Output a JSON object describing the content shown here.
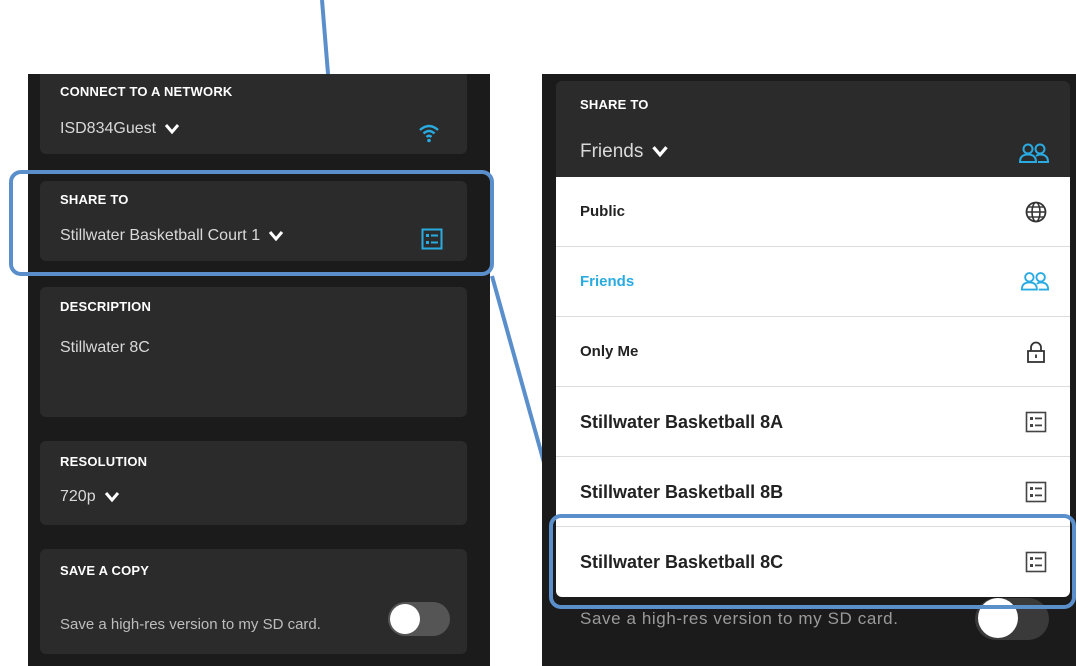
{
  "colors": {
    "accent": "#29abe2",
    "panel": "#1b1b1b",
    "card": "#2b2b2b",
    "highlight": "#5b8fcb"
  },
  "left": {
    "network": {
      "label": "CONNECT TO A NETWORK",
      "value": "ISD834Guest",
      "icon": "wifi-icon"
    },
    "share": {
      "label": "SHARE TO",
      "value": "Stillwater Basketball Court 1",
      "icon": "list-icon"
    },
    "description": {
      "label": "DESCRIPTION",
      "value": "Stillwater 8C"
    },
    "resolution": {
      "label": "RESOLUTION",
      "value": "720p"
    },
    "save_copy": {
      "label": "SAVE A COPY",
      "text": "Save a high-res version to my SD card.",
      "enabled": false
    }
  },
  "right": {
    "share": {
      "label": "SHARE TO",
      "value": "Friends",
      "icon": "friends-icon"
    },
    "options": [
      {
        "label": "Public",
        "icon": "globe-icon",
        "selected": false
      },
      {
        "label": "Friends",
        "icon": "friends-icon",
        "selected": true
      },
      {
        "label": "Only Me",
        "icon": "lock-icon",
        "selected": false
      },
      {
        "label": "Stillwater Basketball 8A",
        "icon": "list-icon",
        "selected": false
      },
      {
        "label": "Stillwater Basketball 8B",
        "icon": "list-icon",
        "selected": false
      },
      {
        "label": "Stillwater Basketball 8C",
        "icon": "list-icon",
        "selected": false
      }
    ],
    "save_copy_text": "Save a high-res version to my SD card."
  }
}
